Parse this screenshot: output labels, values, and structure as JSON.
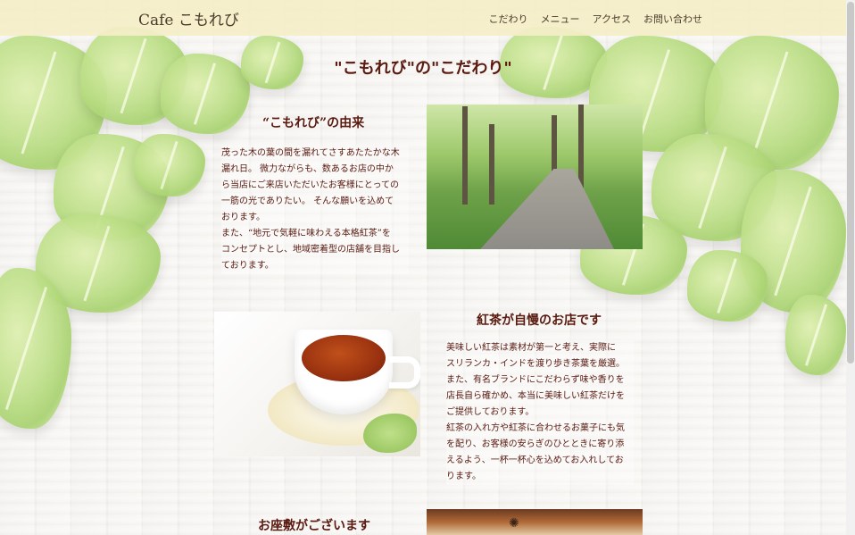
{
  "header": {
    "brand": "Cafe こもれび",
    "nav": [
      "こだわり",
      "メニュー",
      "アクセス",
      "お問い合わせ"
    ]
  },
  "main": {
    "page_title": "\"こもれび\"の\"こだわり\"",
    "sections": [
      {
        "title": "“こもれび”の由来",
        "lines": [
          "茂った木の葉の間を漏れてさすあたたかな木",
          "漏れ日。 微力ながらも、数あるお店の中か",
          "ら当店にご来店いただいたお客様にとっての",
          "一筋の光でありたい。 そんな願いを込めて",
          "おります。",
          "また、“地元で気軽に味わえる本格紅茶”を",
          "コンセプトとし、地域密着型の店舗を目指し",
          "ております。"
        ]
      },
      {
        "title": "紅茶が自慢のお店です",
        "lines": [
          "美味しい紅茶は素材が第一と考え、実際に",
          "スリランカ・インドを渡り歩き茶葉を厳選。",
          "また、有名ブランドにこだわらず味や香りを",
          "店長自ら確かめ、本当に美味しい紅茶だけを",
          "ご提供しております。",
          "紅茶の入れ方や紅茶に合わせるお菓子にも気",
          "を配り、お客様の安らぎのひとときに寄り添",
          "えるよう、一杯一杯心を込めてお入れしてお",
          "ります。"
        ]
      },
      {
        "title": "お座敷がございます"
      }
    ]
  },
  "colors": {
    "header_bg": "#f4eec8",
    "title_text": "#5a1a10",
    "body_text": "#5a1a10"
  },
  "icons": [
    "ivy-leaf-decoration",
    "sun-ornament-icon"
  ]
}
